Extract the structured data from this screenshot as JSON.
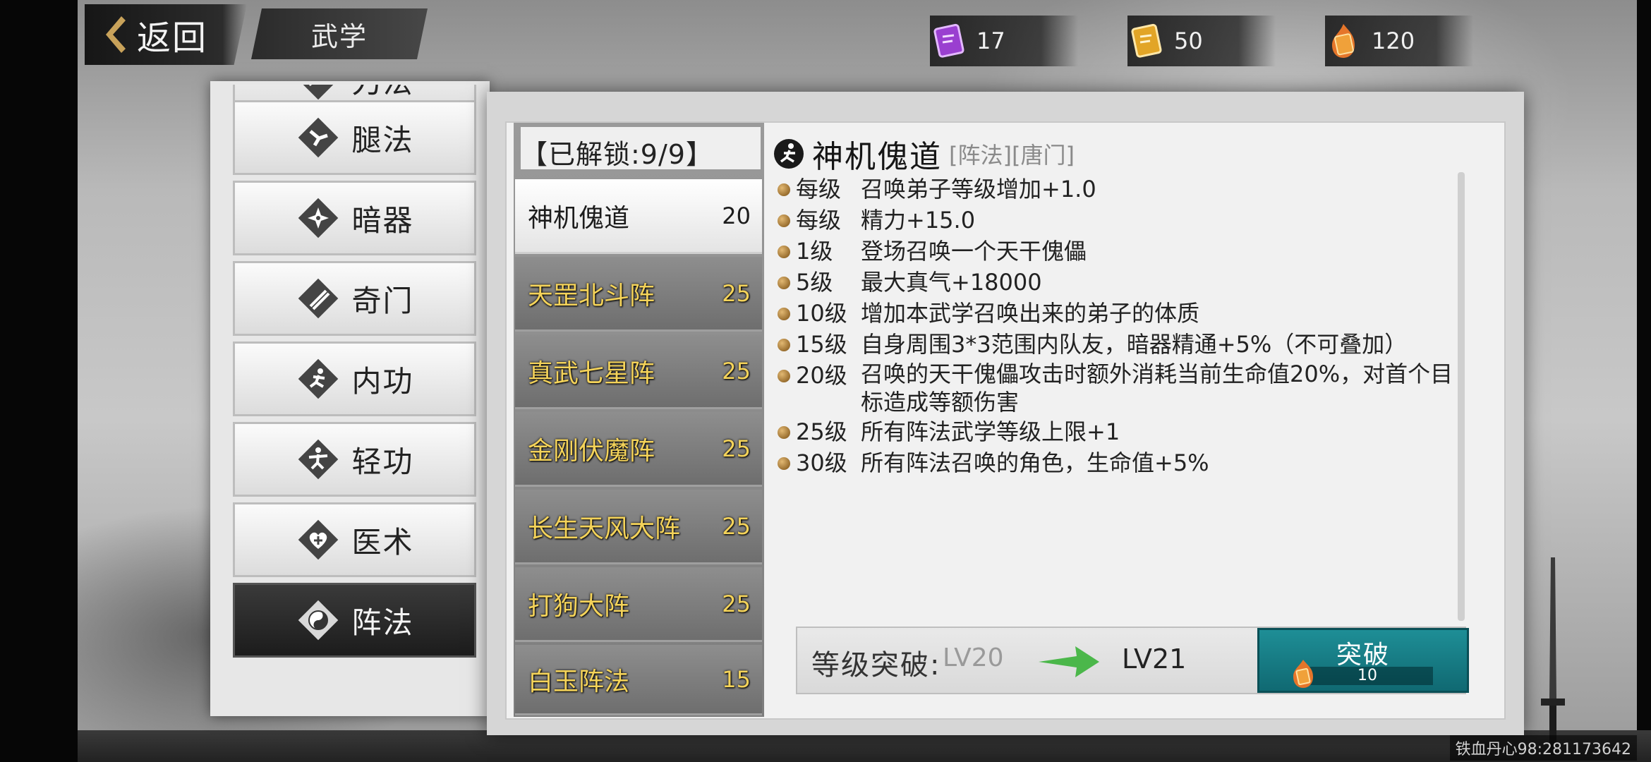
{
  "header": {
    "back_label": "返回",
    "title": "武学"
  },
  "resources": [
    {
      "icon": "purple-scroll-icon",
      "value": "17",
      "color": "#a24ad6"
    },
    {
      "icon": "gold-scroll-icon",
      "value": "50",
      "color": "#e2a527"
    },
    {
      "icon": "fire-scroll-icon",
      "value": "120",
      "color": "#e5752a"
    }
  ],
  "categories": [
    {
      "label": "刀法",
      "icon": "blade-icon"
    },
    {
      "label": "腿法",
      "icon": "kick-icon"
    },
    {
      "label": "暗器",
      "icon": "shuriken-icon"
    },
    {
      "label": "奇门",
      "icon": "scroll-weapon-icon"
    },
    {
      "label": "内功",
      "icon": "inner-power-icon"
    },
    {
      "label": "轻功",
      "icon": "lightness-icon"
    },
    {
      "label": "医术",
      "icon": "medicine-heart-icon"
    },
    {
      "label": "阵法",
      "icon": "yin-yang-icon",
      "active": true
    }
  ],
  "skills": {
    "unlock_label": "【已解锁:9/9】",
    "items": [
      {
        "name": "神机傀道",
        "level": "20",
        "active": true
      },
      {
        "name": "天罡北斗阵",
        "level": "25"
      },
      {
        "name": "真武七星阵",
        "level": "25"
      },
      {
        "name": "金刚伏魔阵",
        "level": "25"
      },
      {
        "name": "长生天风大阵",
        "level": "25"
      },
      {
        "name": "打狗大阵",
        "level": "25"
      },
      {
        "name": "白玉阵法",
        "level": "15"
      }
    ]
  },
  "detail": {
    "name": "神机傀道",
    "tags": "[阵法][唐门]",
    "rows": [
      {
        "lv": "每级",
        "text": "召唤弟子等级增加+1.0"
      },
      {
        "lv": "每级",
        "text": "精力+15.0"
      },
      {
        "lv": "1级",
        "text": "登场召唤一个天干傀儡"
      },
      {
        "lv": "5级",
        "text": "最大真气+18000"
      },
      {
        "lv": "10级",
        "text": "增加本武学召唤出来的弟子的体质"
      },
      {
        "lv": "15级",
        "text": "自身周围3*3范围内队友，暗器精通+5%（不可叠加）"
      },
      {
        "lv": "20级",
        "text": "召唤的天干傀儡攻击时额外消耗当前生命值20%，对首个目标造成等额伤害"
      },
      {
        "lv": "25级",
        "text": "所有阵法武学等级上限+1"
      },
      {
        "lv": "30级",
        "text": "所有阵法召唤的角色，生命值+5%"
      }
    ]
  },
  "breakthrough": {
    "label": "等级突破:",
    "from": "LV20",
    "to": "LV21",
    "button_label": "突破",
    "cost": "10"
  },
  "watermark": "铁血丹心98:281173642"
}
